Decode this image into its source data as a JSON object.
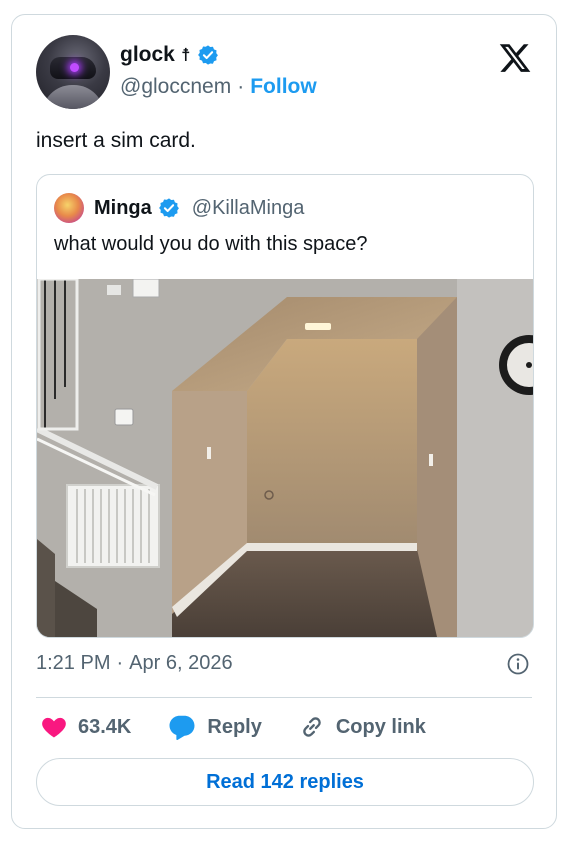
{
  "author": {
    "display_name": "glock",
    "name_emoji": "☨",
    "handle": "@gloccnem",
    "separator": "·",
    "follow_label": "Follow"
  },
  "tweet": {
    "text": "insert a sim card.",
    "time": "1:21 PM",
    "separator": "·",
    "date": "Apr 6, 2026"
  },
  "quote": {
    "display_name": "Minga",
    "handle": "@KillaMinga",
    "text": "what would you do with this space?"
  },
  "actions": {
    "likes": "63.4K",
    "reply_label": "Reply",
    "copy_label": "Copy link"
  },
  "read_replies_label": "Read 142 replies",
  "colors": {
    "brand_blue": "#1d9bf0",
    "like_pink": "#f91880",
    "text_secondary": "#536471",
    "border": "#cfd9de"
  }
}
